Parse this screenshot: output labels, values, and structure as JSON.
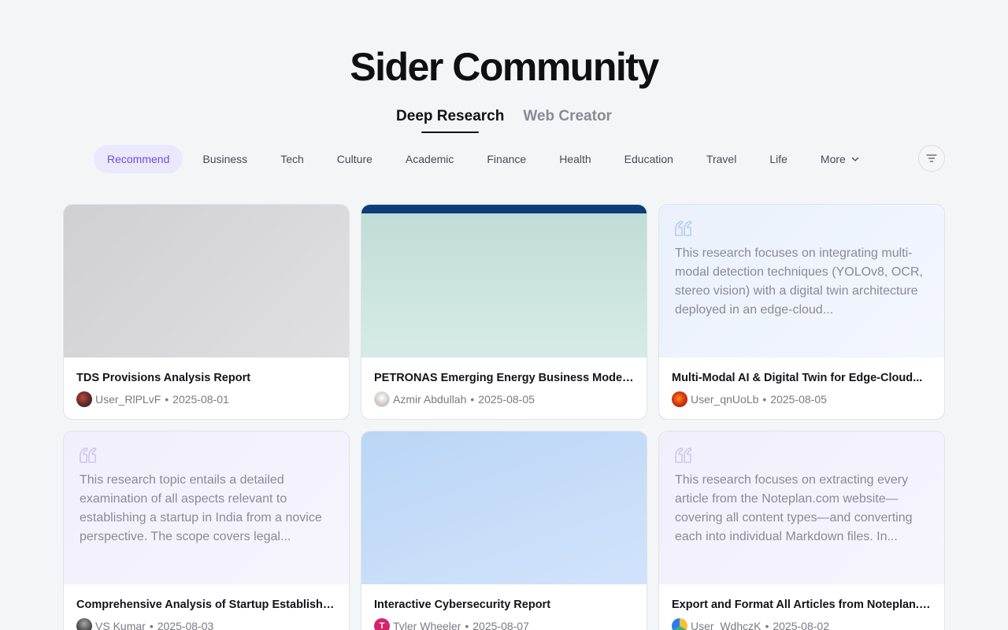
{
  "title": "Sider Community",
  "mode_tabs": [
    {
      "label": "Deep Research",
      "active": true
    },
    {
      "label": "Web Creator",
      "active": false
    }
  ],
  "categories": [
    {
      "label": "Recommend",
      "active": true
    },
    {
      "label": "Business"
    },
    {
      "label": "Tech"
    },
    {
      "label": "Culture"
    },
    {
      "label": "Academic"
    },
    {
      "label": "Finance"
    },
    {
      "label": "Health"
    },
    {
      "label": "Education"
    },
    {
      "label": "Travel"
    },
    {
      "label": "Life"
    }
  ],
  "more_label": "More",
  "filter_icon": "filter-lines-icon",
  "accent_color": "#6d4fd6",
  "cards": [
    {
      "title": "TDS Provisions Analysis Report",
      "author": "User_RlPLvF",
      "date": "2025-08-01",
      "thumb": "image"
    },
    {
      "title": "PETRONAS Emerging Energy Business Models...",
      "author": "Azmir Abdullah",
      "date": "2025-08-05",
      "thumb": "image"
    },
    {
      "title": "Multi-Modal AI & Digital Twin for Edge-Cloud...",
      "author": "User_qnUoLb",
      "date": "2025-08-05",
      "thumb": "quote",
      "excerpt": "This research focuses on integrating multi-modal detection techniques (YOLOv8, OCR, stereo vision) with a digital twin architecture deployed in an edge-cloud..."
    },
    {
      "title": "Comprehensive Analysis of Startup Establishme...",
      "author": "VS Kumar",
      "date": "2025-08-03",
      "thumb": "quote",
      "excerpt": "This research topic entails a detailed examination of all aspects relevant to establishing a startup in India from a novice perspective. The scope covers legal..."
    },
    {
      "title": "Interactive Cybersecurity Report",
      "author": "Tyler Wheeler",
      "date": "2025-08-07",
      "thumb": "image",
      "avatar_letter": "T"
    },
    {
      "title": "Export and Format All Articles from Noteplan.co...",
      "author": "User_WdhczK",
      "date": "2025-08-02",
      "thumb": "quote",
      "excerpt": "This research focuses on extracting every article from the Noteplan.com website—covering all content types—and converting each into individual Markdown files. In..."
    }
  ],
  "separator": "•"
}
